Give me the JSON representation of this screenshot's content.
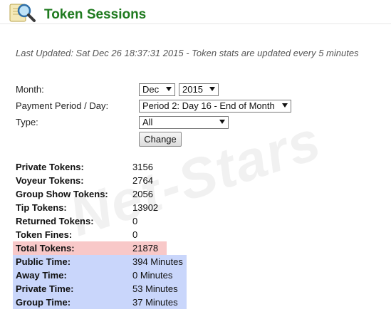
{
  "header": {
    "title": "Token Sessions",
    "icon": "magnifier-icon"
  },
  "last_updated": "Last Updated: Sat Dec 26 18:37:31 2015 - Token stats are updated every 5 minutes",
  "filters": {
    "month_label": "Month:",
    "month_value": "Dec",
    "year_value": "2015",
    "period_label": "Payment Period / Day:",
    "period_value": "Period 2: Day 16 - End of Month",
    "type_label": "Type:",
    "type_value": "All",
    "change_button": "Change"
  },
  "stats": [
    {
      "label": "Private Tokens:",
      "value": "3156"
    },
    {
      "label": "Voyeur Tokens:",
      "value": "2764"
    },
    {
      "label": "Group Show Tokens:",
      "value": "2056"
    },
    {
      "label": "Tip Tokens:",
      "value": "13902"
    },
    {
      "label": "Returned Tokens:",
      "value": "0"
    },
    {
      "label": "Token Fines:",
      "value": "0"
    },
    {
      "label": "Total Tokens:",
      "value": "21878"
    }
  ],
  "times": [
    {
      "label": "Public Time:",
      "value": "394 Minutes"
    },
    {
      "label": "Away Time:",
      "value": "0 Minutes"
    },
    {
      "label": "Private Time:",
      "value": "53 Minutes"
    },
    {
      "label": "Group Time:",
      "value": "37 Minutes"
    }
  ],
  "watermark": "Net-Stars",
  "colors": {
    "title": "#1f7a1f",
    "total_highlight": "#f8c8c8",
    "time_highlight": "#c9d6fb"
  }
}
